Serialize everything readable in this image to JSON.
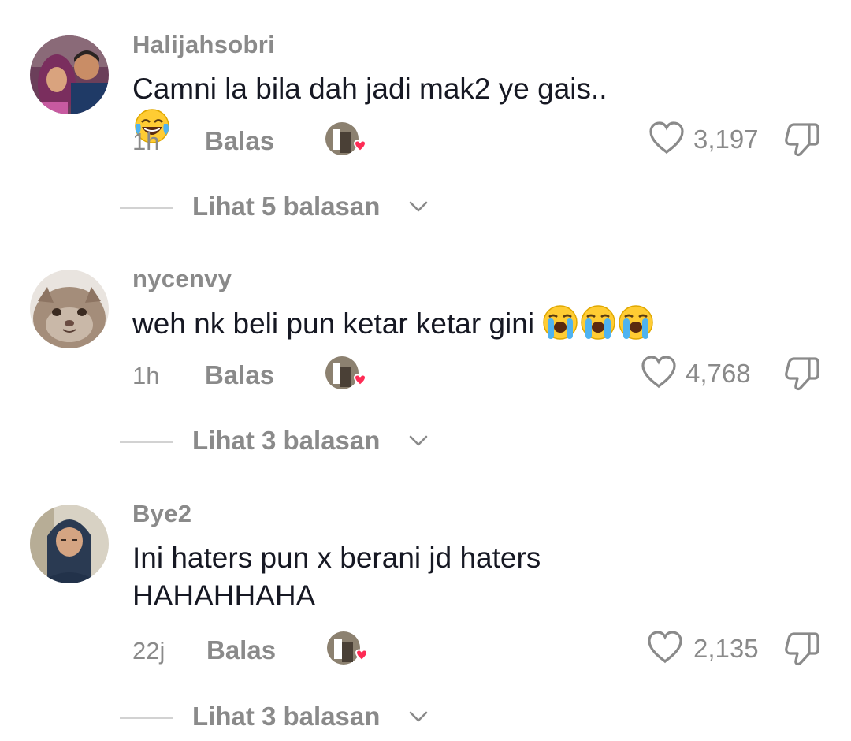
{
  "comments": [
    {
      "username": "Halijahsobri",
      "text": "Camni la bila dah jadi mak2 ye gais..",
      "emojis": [
        "laughing-tears-emoji"
      ],
      "time": "1h",
      "reply_label": "Balas",
      "likes": "3,197",
      "view_replies": "Lihat 5 balasan"
    },
    {
      "username": "nycenvy",
      "text": "weh nk beli pun ketar ketar gini",
      "emojis": [
        "loudly-crying-emoji",
        "loudly-crying-emoji",
        "loudly-crying-emoji"
      ],
      "time": "1h",
      "reply_label": "Balas",
      "likes": "4,768",
      "view_replies": "Lihat 3 balasan"
    },
    {
      "username": "Bye2",
      "text_line1": "Ini haters pun x berani jd haters",
      "text_line2": "HAHAHHAHA",
      "time": "22j",
      "reply_label": "Balas",
      "likes": "2,135",
      "view_replies": "Lihat 3 balasan"
    }
  ],
  "icons": {
    "like": "heart-outline-icon",
    "dislike": "thumbs-down-icon",
    "expand": "chevron-down-icon",
    "creator_liked": "heart-badge-icon"
  },
  "colors": {
    "text": "#161823",
    "muted": "#8a8a8a",
    "heart_badge": "#fe2c55",
    "divider": "#d2d2d2"
  }
}
